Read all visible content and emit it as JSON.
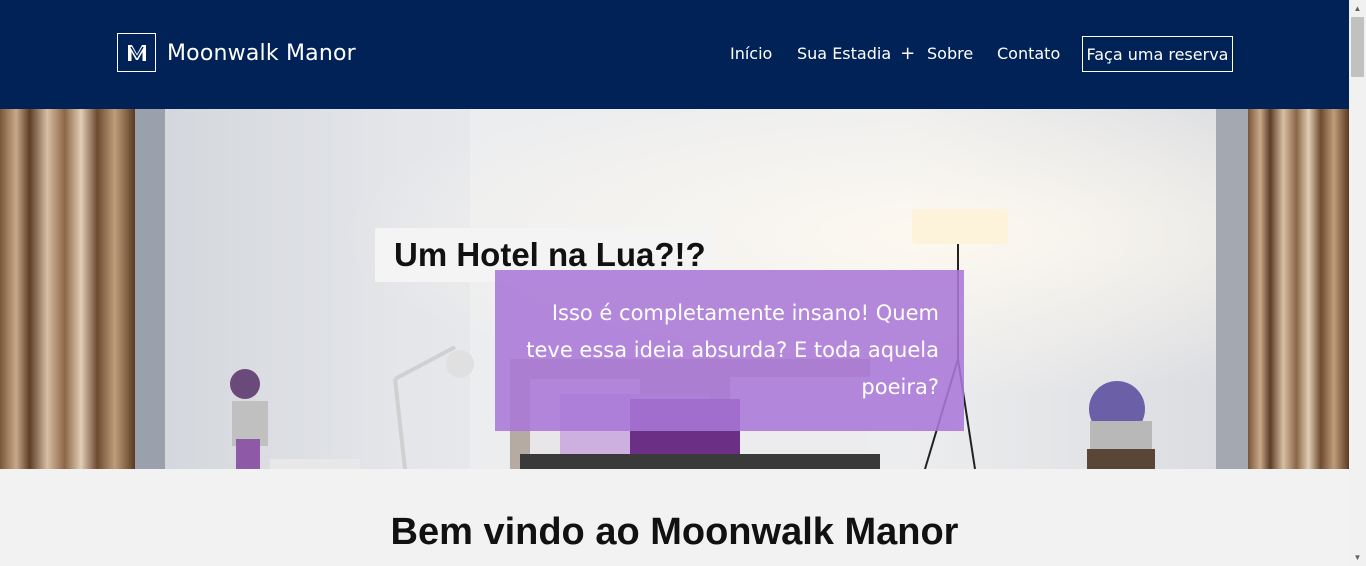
{
  "header": {
    "brand_name": "Moonwalk Manor",
    "logo_icon": "moonwalk-m-logo-icon",
    "background_color": "#002257",
    "nav": [
      {
        "label": "Início"
      },
      {
        "label": "Sua Estadia",
        "suffix": "+"
      },
      {
        "label": "Sobre"
      },
      {
        "label": "Contato"
      }
    ],
    "cta_label": "Faça uma reserva"
  },
  "hero": {
    "title": "Um Hotel na Lua?!?",
    "subtitle": "Isso é completamente insano! Quem teve essa ideia absurda? E toda aquela poeira?",
    "overlay_color": "#aa78d7"
  },
  "main": {
    "heading": "Bem vindo ao Moonwalk Manor"
  }
}
